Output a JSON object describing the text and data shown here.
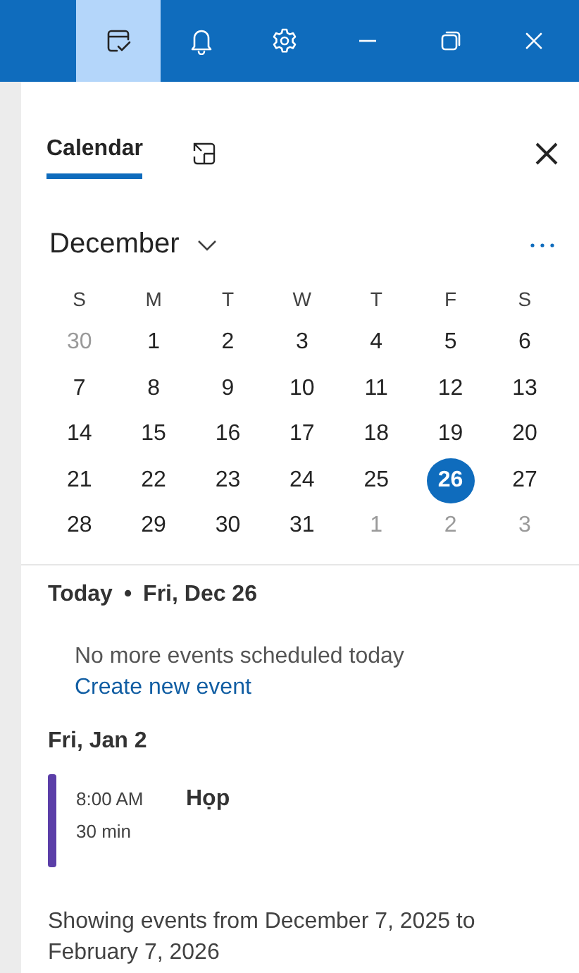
{
  "toolbar": [
    {
      "kind": "calendar-check",
      "selected": true
    },
    {
      "kind": "bell",
      "selected": false
    },
    {
      "kind": "gear",
      "selected": false
    },
    {
      "kind": "minimize",
      "selected": false
    },
    {
      "kind": "restore",
      "selected": false
    },
    {
      "kind": "close",
      "selected": false
    }
  ],
  "tabs": [
    {
      "label": "Calendar",
      "selected": true
    }
  ],
  "month": "December",
  "weekdays": [
    "S",
    "M",
    "T",
    "W",
    "T",
    "F",
    "S"
  ],
  "weeks": [
    [
      {
        "day": "30",
        "outside": true,
        "selected": false
      },
      {
        "day": "1",
        "outside": false,
        "selected": false
      },
      {
        "day": "2",
        "outside": false,
        "selected": false
      },
      {
        "day": "3",
        "outside": false,
        "selected": false
      },
      {
        "day": "4",
        "outside": false,
        "selected": false
      },
      {
        "day": "5",
        "outside": false,
        "selected": false
      },
      {
        "day": "6",
        "outside": false,
        "selected": false
      }
    ],
    [
      {
        "day": "7",
        "outside": false,
        "selected": false
      },
      {
        "day": "8",
        "outside": false,
        "selected": false
      },
      {
        "day": "9",
        "outside": false,
        "selected": false
      },
      {
        "day": "10",
        "outside": false,
        "selected": false
      },
      {
        "day": "11",
        "outside": false,
        "selected": false
      },
      {
        "day": "12",
        "outside": false,
        "selected": false
      },
      {
        "day": "13",
        "outside": false,
        "selected": false
      }
    ],
    [
      {
        "day": "14",
        "outside": false,
        "selected": false
      },
      {
        "day": "15",
        "outside": false,
        "selected": false
      },
      {
        "day": "16",
        "outside": false,
        "selected": false
      },
      {
        "day": "17",
        "outside": false,
        "selected": false
      },
      {
        "day": "18",
        "outside": false,
        "selected": false
      },
      {
        "day": "19",
        "outside": false,
        "selected": false
      },
      {
        "day": "20",
        "outside": false,
        "selected": false
      }
    ],
    [
      {
        "day": "21",
        "outside": false,
        "selected": false
      },
      {
        "day": "22",
        "outside": false,
        "selected": false
      },
      {
        "day": "23",
        "outside": false,
        "selected": false
      },
      {
        "day": "24",
        "outside": false,
        "selected": false
      },
      {
        "day": "25",
        "outside": false,
        "selected": false
      },
      {
        "day": "26",
        "outside": false,
        "selected": true
      },
      {
        "day": "27",
        "outside": false,
        "selected": false
      }
    ],
    [
      {
        "day": "28",
        "outside": false,
        "selected": false
      },
      {
        "day": "29",
        "outside": false,
        "selected": false
      },
      {
        "day": "30",
        "outside": false,
        "selected": false
      },
      {
        "day": "31",
        "outside": false,
        "selected": false
      },
      {
        "day": "1",
        "outside": true,
        "selected": false
      },
      {
        "day": "2",
        "outside": true,
        "selected": false
      },
      {
        "day": "3",
        "outside": true,
        "selected": false
      }
    ]
  ],
  "today": {
    "label": "Today",
    "separator": "•",
    "date": "Fri, Dec 26",
    "message": "No more events scheduled today",
    "link": "Create new event"
  },
  "days": [
    {
      "date": "Fri, Jan 2",
      "events": [
        {
          "time": "8:00 AM",
          "duration": "30 min",
          "title": "Họp",
          "color": "#5b3ea8"
        }
      ]
    }
  ],
  "footer": "Showing events from December 7, 2025 to February 7, 2026"
}
